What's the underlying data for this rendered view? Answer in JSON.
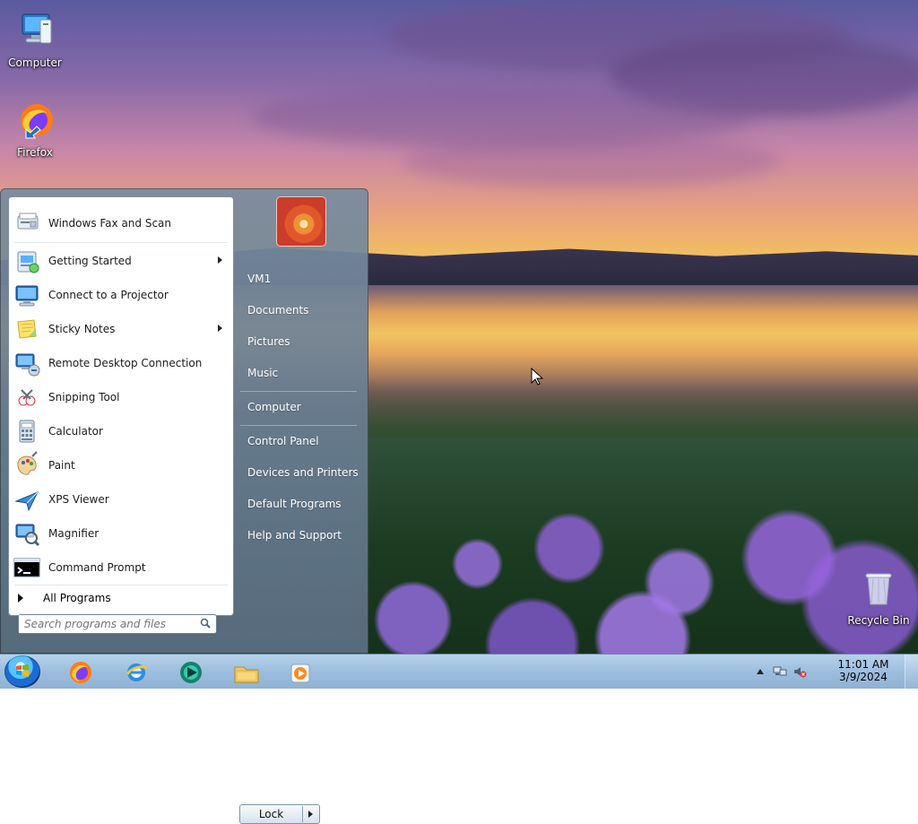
{
  "desktop": {
    "icons": [
      {
        "label": "Computer"
      },
      {
        "label": "Firefox"
      },
      {
        "label": "Recycle Bin"
      }
    ]
  },
  "start_menu": {
    "programs": [
      {
        "label": "Windows Fax and Scan",
        "has_submenu": false,
        "icon": "fax-scanner-icon"
      },
      {
        "label": "Getting Started",
        "has_submenu": true,
        "icon": "getting-started-icon"
      },
      {
        "label": "Connect to a Projector",
        "has_submenu": false,
        "icon": "projector-icon"
      },
      {
        "label": "Sticky Notes",
        "has_submenu": true,
        "icon": "sticky-notes-icon"
      },
      {
        "label": "Remote Desktop Connection",
        "has_submenu": false,
        "icon": "remote-desktop-icon"
      },
      {
        "label": "Snipping Tool",
        "has_submenu": false,
        "icon": "snipping-tool-icon"
      },
      {
        "label": "Calculator",
        "has_submenu": false,
        "icon": "calculator-icon"
      },
      {
        "label": "Paint",
        "has_submenu": false,
        "icon": "paint-palette-icon"
      },
      {
        "label": "XPS Viewer",
        "has_submenu": false,
        "icon": "xps-viewer-icon"
      },
      {
        "label": "Magnifier",
        "has_submenu": false,
        "icon": "magnifier-icon"
      },
      {
        "label": "Command Prompt",
        "has_submenu": false,
        "icon": "command-prompt-icon"
      }
    ],
    "all_programs_label": "All Programs",
    "search": {
      "placeholder": "Search programs and files"
    },
    "right": {
      "user": "VM1",
      "links": [
        "Documents",
        "Pictures",
        "Music",
        "Computer",
        "Control Panel",
        "Devices and Printers",
        "Default Programs",
        "Help and Support"
      ]
    },
    "lock_button_label": "Lock"
  },
  "taskbar": {
    "pinned": [
      "start-orb",
      "firefox",
      "internet-explorer",
      "media-center",
      "file-explorer",
      "media-player"
    ],
    "clock": {
      "time": "11:01 AM",
      "date": "3/9/2024"
    }
  },
  "colors": {
    "accent": "#1b6bd3",
    "start_menu_bg": "#6f869c",
    "taskbar_bg": "#9ec0df"
  }
}
